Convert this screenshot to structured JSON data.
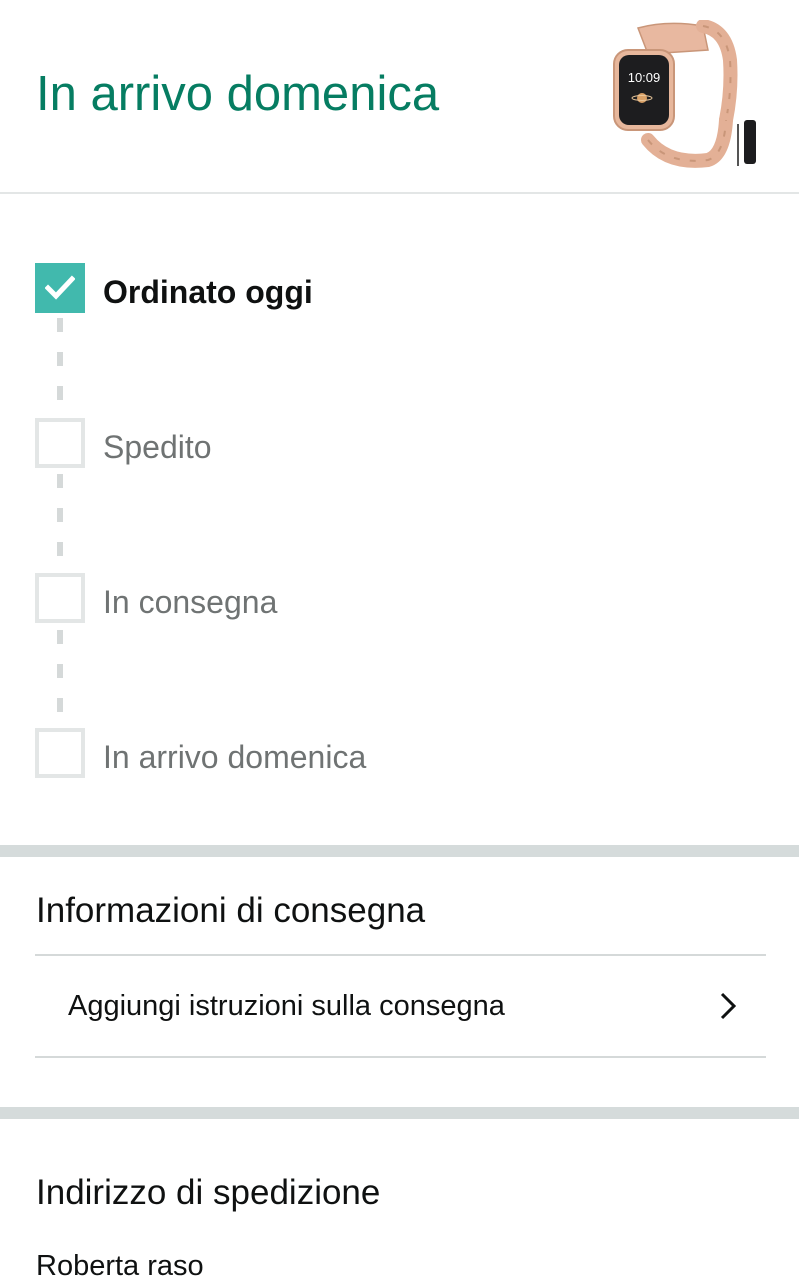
{
  "header": {
    "title": "In arrivo domenica",
    "product_image_icon": "watch-product-image",
    "watch_time": "10:09"
  },
  "tracker": {
    "steps": [
      {
        "label": "Ordinato oggi",
        "completed": true
      },
      {
        "label": "Spedito",
        "completed": false
      },
      {
        "label": "In consegna",
        "completed": false
      },
      {
        "label": "In arrivo domenica",
        "completed": false
      }
    ]
  },
  "delivery_info": {
    "title": "Informazioni di consegna",
    "add_instructions_label": "Aggiungi istruzioni sulla consegna",
    "chevron_icon": "chevron-right-icon"
  },
  "shipping_address": {
    "title": "Indirizzo di spedizione",
    "name": "Roberta raso"
  },
  "colors": {
    "accent": "#067d62",
    "step_done": "#41b9ad",
    "divider": "#d5dbdb"
  }
}
